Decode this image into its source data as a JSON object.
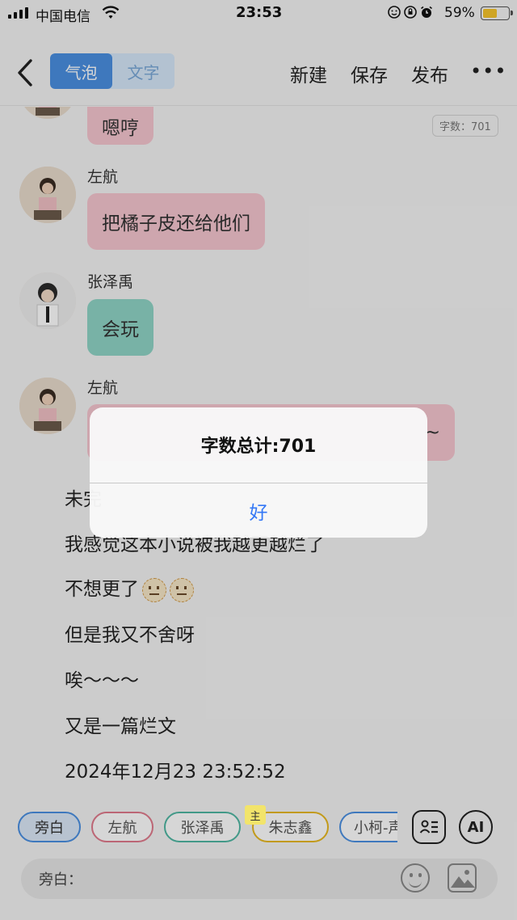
{
  "status_bar": {
    "carrier": "中国电信",
    "time": "23:53",
    "battery_percent": "59%",
    "battery_level": 0.59,
    "icons": [
      "signal-icon",
      "wifi-icon",
      "face-id-icon",
      "orientation-lock-icon",
      "alarm-icon",
      "battery-icon"
    ]
  },
  "nav": {
    "mode_tabs": [
      {
        "label": "气泡",
        "active": true
      },
      {
        "label": "文字",
        "active": false
      }
    ],
    "new_label": "新建",
    "save_label": "保存",
    "publish_label": "发布",
    "more_label": "•••"
  },
  "chat": {
    "word_count_badge": "字数：701",
    "messages": [
      {
        "speaker": "",
        "text": "嗯哼",
        "color": "pink"
      },
      {
        "speaker": "左航",
        "text": "把橘子皮还给他们",
        "color": "pink"
      },
      {
        "speaker": "张泽禹",
        "text": "会玩",
        "color": "teal"
      },
      {
        "speaker": "左航",
        "text": "~",
        "color": "pink"
      }
    ],
    "narration": [
      "未完",
      "我感觉这本小说被我越更越烂了",
      "不想更了",
      "但是我又不舍呀",
      "唉～～～",
      "又是一篇烂文",
      "2024年12月23 23:52:52"
    ]
  },
  "bottom": {
    "characters": [
      {
        "name": "旁白",
        "color": "#4a90e2",
        "selected": true
      },
      {
        "name": "左航",
        "color": "#e07a8c",
        "selected": false
      },
      {
        "name": "张泽禹",
        "color": "#4fb7a3",
        "selected": false
      },
      {
        "name": "朱志鑫",
        "color": "#e8b820",
        "selected": false,
        "badge": "主"
      },
      {
        "name": "小柯-声",
        "color": "#4a90e2",
        "selected": false
      }
    ],
    "ai_label": "AI",
    "input_label": "旁白："
  },
  "alert": {
    "title": "字数总计:701",
    "confirm_label": "好"
  },
  "colors": {
    "accent": "#4a90e2",
    "pink_bubble": "#f6c6d0",
    "teal_bubble": "#8fd4c6",
    "ios_link": "#3478f6"
  }
}
